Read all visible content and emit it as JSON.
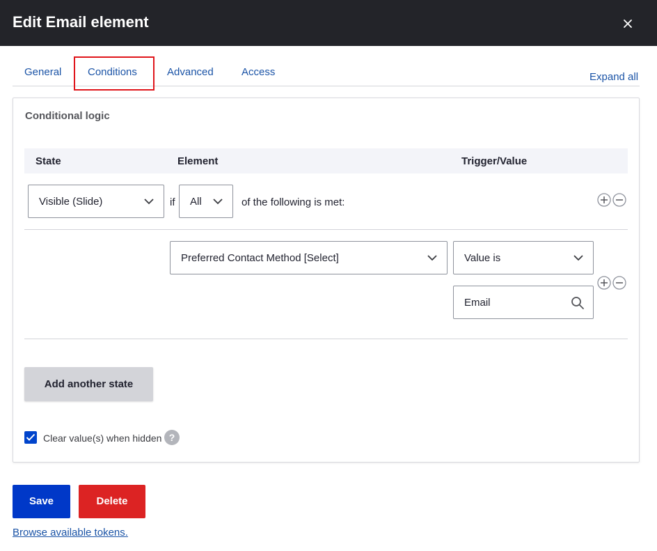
{
  "dialog": {
    "title": "Edit Email element",
    "close_icon": "close-icon"
  },
  "tabs": [
    {
      "label": "General"
    },
    {
      "label": "Conditions",
      "active": true
    },
    {
      "label": "Advanced"
    },
    {
      "label": "Access"
    }
  ],
  "expand_all": "Expand all",
  "conditional_logic": {
    "title": "Conditional logic",
    "columns": {
      "state": "State",
      "element": "Element",
      "trigger": "Trigger/Value"
    },
    "state_row": {
      "state_value": "Visible (Slide)",
      "if_text": "if",
      "operator_value": "All",
      "suffix_text": "of the following is met:"
    },
    "condition_row": {
      "element_value": "Preferred Contact Method [Select]",
      "trigger_value": "Value is",
      "value_text": "Email"
    },
    "add_state_label": "Add another state",
    "clear_checkbox": {
      "label": "Clear value(s) when hidden",
      "checked": true
    },
    "help_glyph": "?"
  },
  "actions": {
    "save_label": "Save",
    "delete_label": "Delete",
    "tokens_link": "Browse available tokens."
  },
  "colors": {
    "header_bg": "#232429",
    "link": "#1a53a6",
    "highlight_border": "#e0151b",
    "save_bg": "#0038c8",
    "delete_bg": "#dc2323",
    "checkbox": "#0044cc"
  }
}
